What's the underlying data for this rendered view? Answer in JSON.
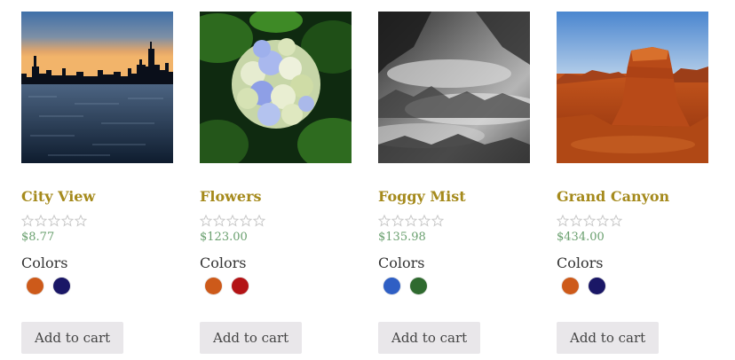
{
  "products": [
    {
      "title": "City View",
      "price": "$8.77",
      "rating_stars": 0,
      "colors_label": "Colors",
      "swatches": [
        "#cd5a1a",
        "#1a1766"
      ],
      "button_label": "Add to cart",
      "image": "city-skyline-sunset"
    },
    {
      "title": "Flowers",
      "price": "$123.00",
      "rating_stars": 0,
      "colors_label": "Colors",
      "swatches": [
        "#cd5a1a",
        "#b31315"
      ],
      "button_label": "Add to cart",
      "image": "hydrangea-flower"
    },
    {
      "title": "Foggy Mist",
      "price": "$135.98",
      "rating_stars": 0,
      "colors_label": "Colors",
      "swatches": [
        "#2f5fc4",
        "#2f6a2f"
      ],
      "button_label": "Add to cart",
      "image": "foggy-forest"
    },
    {
      "title": "Grand Canyon",
      "price": "$434.00",
      "rating_stars": 0,
      "colors_label": "Colors",
      "swatches": [
        "#cd5a1a",
        "#1a1766"
      ],
      "button_label": "Add to cart",
      "image": "desert-butte"
    }
  ],
  "colors": {
    "title": "#a58a1c",
    "price": "#6aa06f",
    "button_bg": "#e9e7ea",
    "star_outline": "#c9c9c9"
  }
}
